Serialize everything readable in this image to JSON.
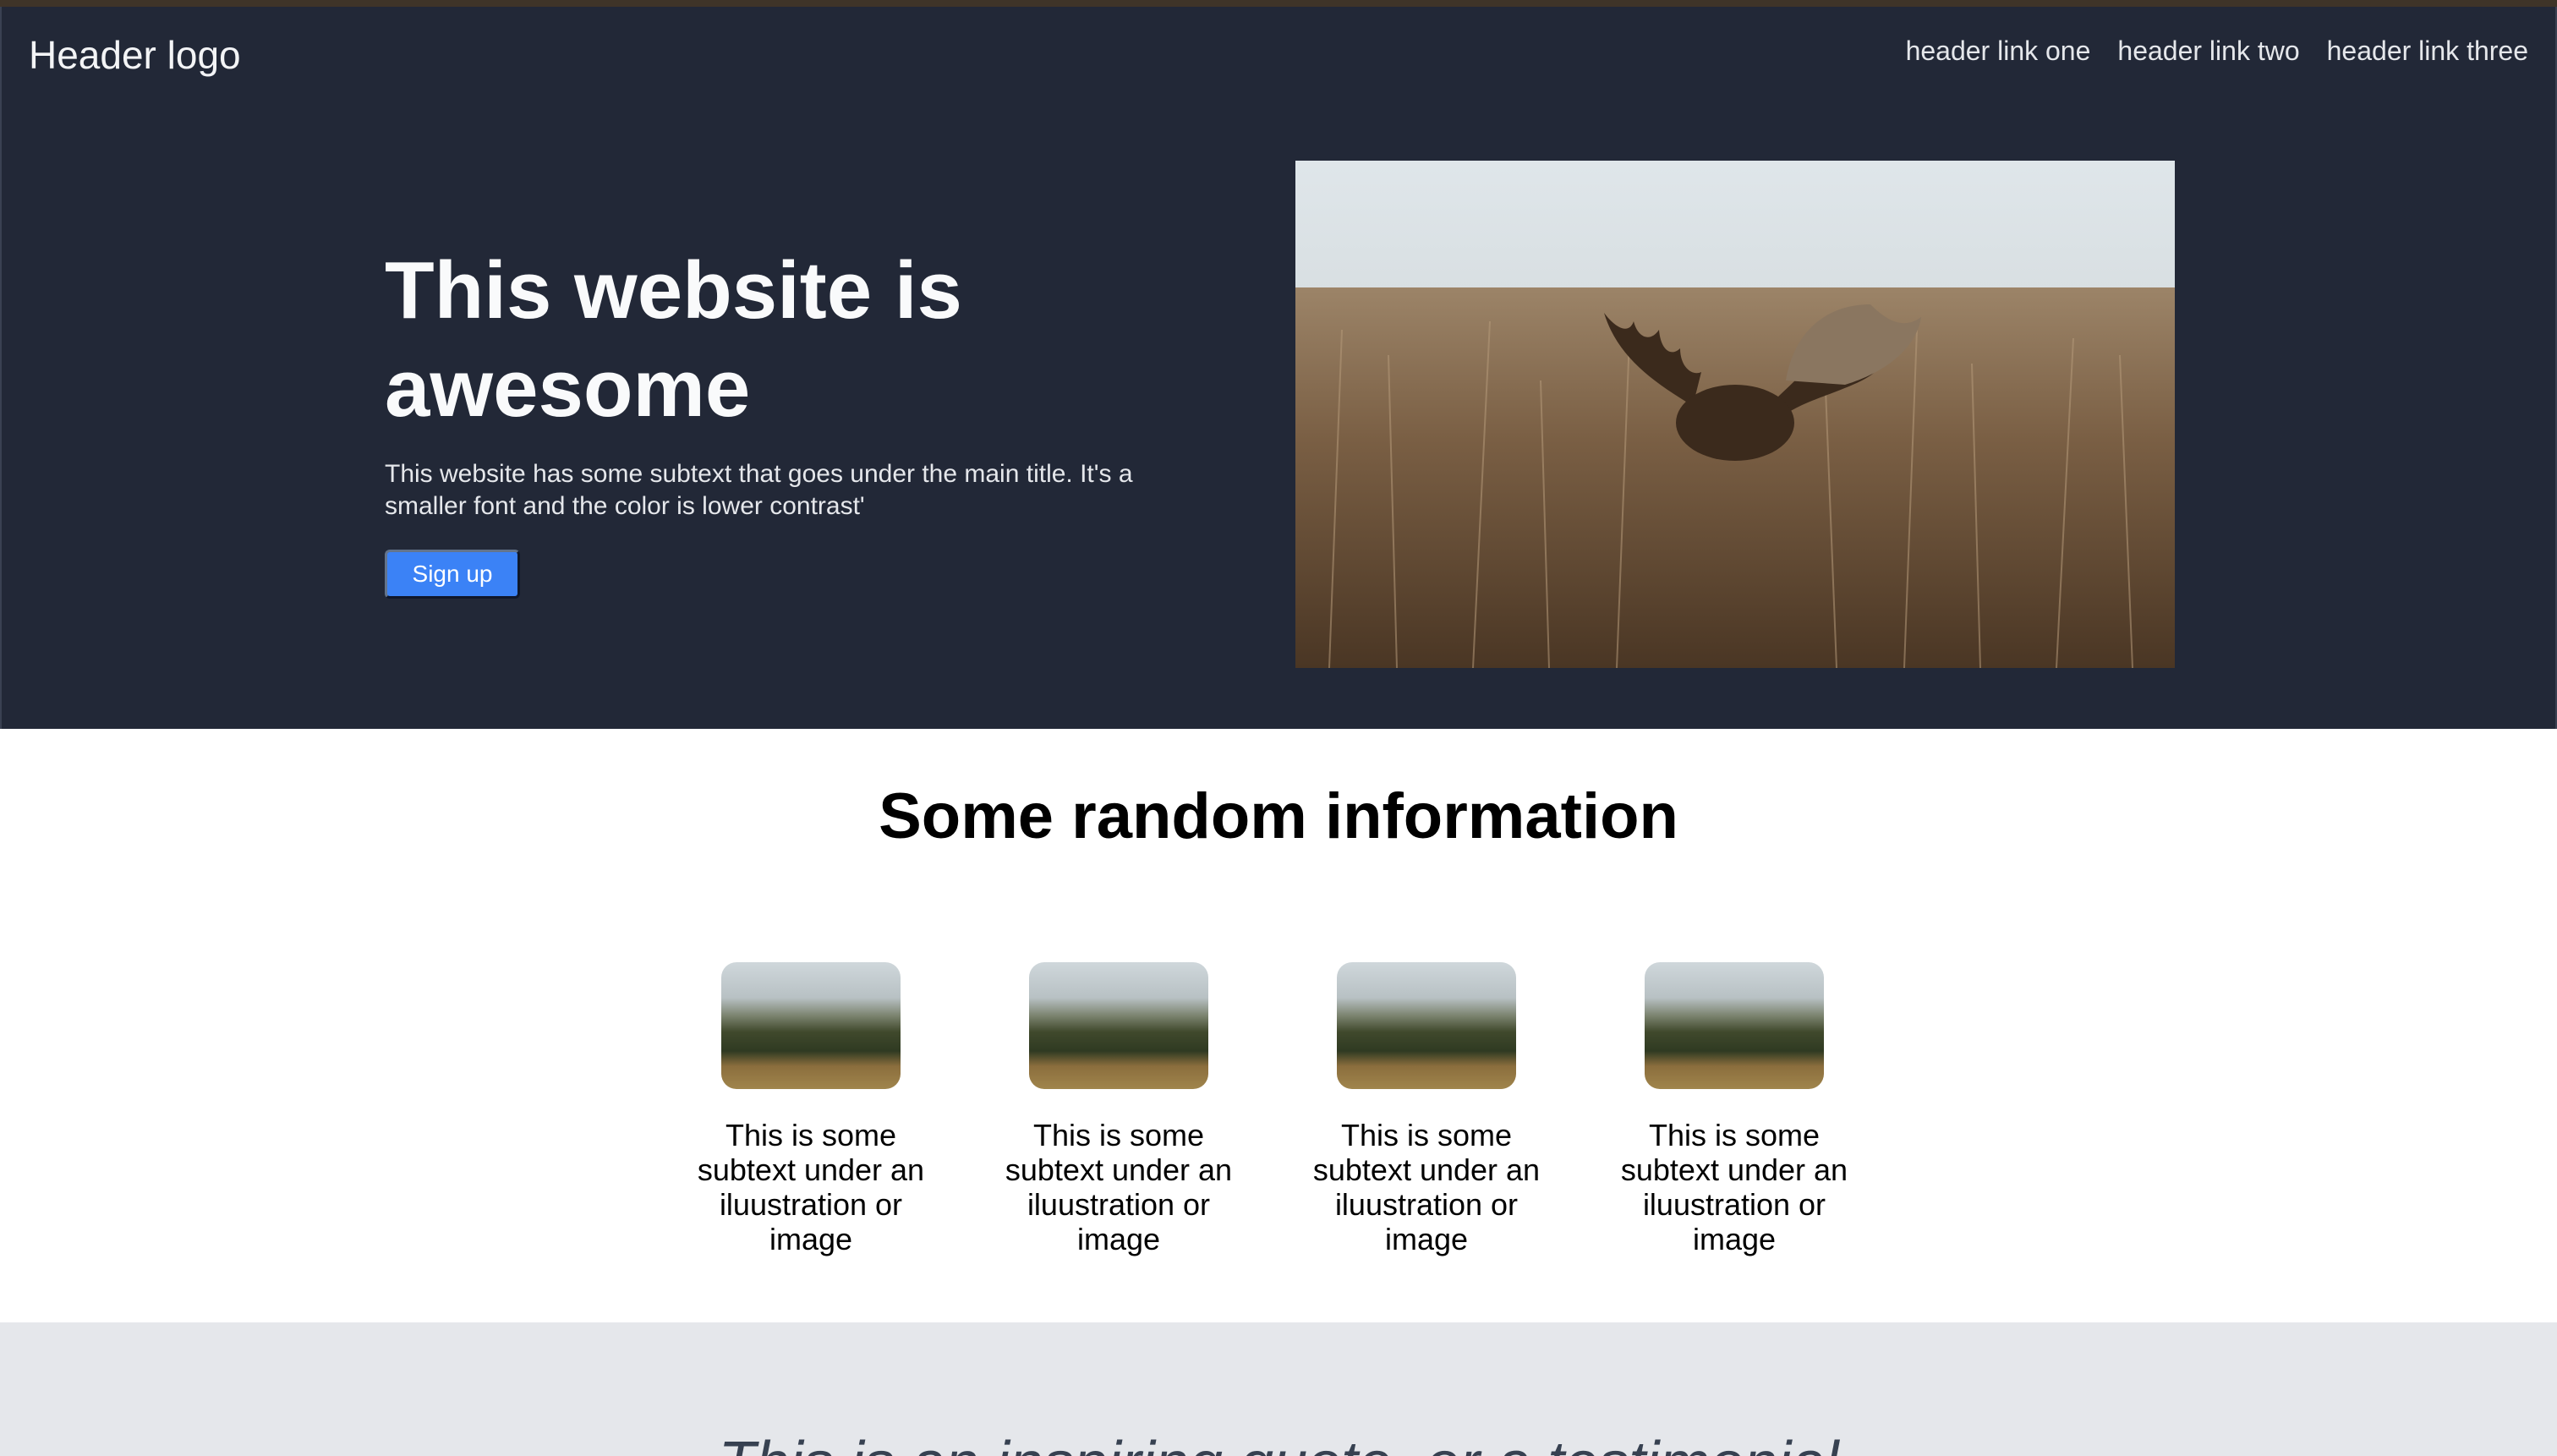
{
  "header": {
    "logo": "Header logo",
    "links": [
      "header link one",
      "header link two",
      "header link three"
    ]
  },
  "hero": {
    "title": "This website is awesome",
    "subtext": "This website has some subtext that goes under the main title. It's a smaller font and the color is lower contrast'",
    "button_label": "Sign up",
    "image": "moose-in-grass-photo"
  },
  "info": {
    "title": "Some random information",
    "cards": [
      {
        "image": "landscape-photo",
        "text": "This is some subtext under an iluustration or image"
      },
      {
        "image": "landscape-photo",
        "text": "This is some subtext under an iluustration or image"
      },
      {
        "image": "landscape-photo",
        "text": "This is some subtext under an iluustration or image"
      },
      {
        "image": "landscape-photo",
        "text": "This is some subtext under an iluustration or image"
      }
    ]
  },
  "quote": {
    "text": "This is an inspiring quote, or a testimonial"
  },
  "colors": {
    "hero_background": "#222837",
    "button": "#3b82f6",
    "quote_background": "#e5e7eb"
  }
}
